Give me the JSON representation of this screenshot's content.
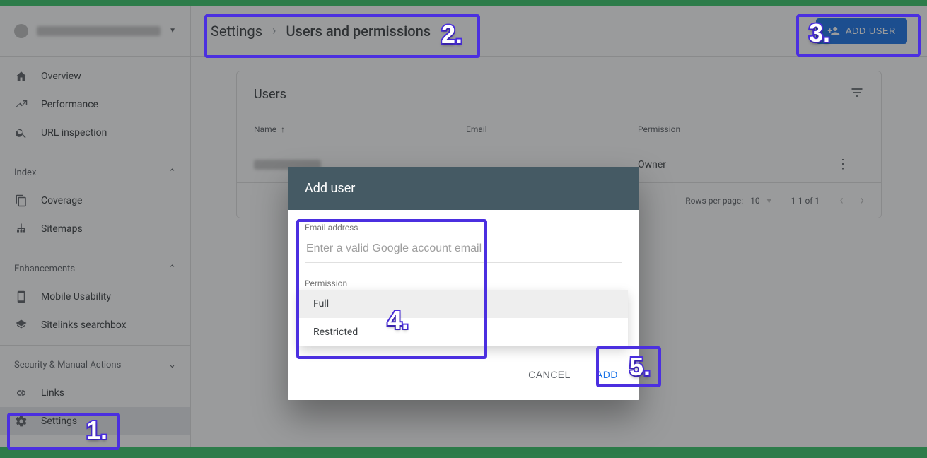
{
  "sidebar": {
    "sections": [
      {
        "items": [
          {
            "name": "overview",
            "label": "Overview",
            "icon": "home"
          },
          {
            "name": "performance",
            "label": "Performance",
            "icon": "trending"
          },
          {
            "name": "url-inspection",
            "label": "URL inspection",
            "icon": "search"
          }
        ]
      },
      {
        "header": "Index",
        "items": [
          {
            "name": "coverage",
            "label": "Coverage",
            "icon": "copy"
          },
          {
            "name": "sitemaps",
            "label": "Sitemaps",
            "icon": "sitemap"
          }
        ]
      },
      {
        "header": "Enhancements",
        "items": [
          {
            "name": "mobile-usability",
            "label": "Mobile Usability",
            "icon": "mobile"
          },
          {
            "name": "sitelinks-searchbox",
            "label": "Sitelinks searchbox",
            "icon": "layers"
          }
        ]
      },
      {
        "header": "Security & Manual Actions",
        "items": [
          {
            "name": "links",
            "label": "Links",
            "icon": "links"
          },
          {
            "name": "settings",
            "label": "Settings",
            "icon": "gear",
            "selected": true
          }
        ]
      }
    ]
  },
  "breadcrumb": {
    "parent": "Settings",
    "current": "Users and permissions"
  },
  "toolbar": {
    "add_user_label": "ADD USER"
  },
  "users_panel": {
    "title": "Users",
    "columns": {
      "name": "Name",
      "email": "Email",
      "permission": "Permission"
    },
    "rows": [
      {
        "permission": "Owner"
      }
    ],
    "footer": {
      "rows_per_page_label": "Rows per page:",
      "page_size": "10",
      "range": "1-1 of 1"
    }
  },
  "dialog": {
    "title": "Add user",
    "email_label": "Email address",
    "email_placeholder": "Enter a valid Google account email",
    "permission_label": "Permission",
    "permission_options": [
      "Full",
      "Restricted"
    ],
    "cancel_label": "CANCEL",
    "add_label": "ADD"
  },
  "annotations": {
    "n1": "1.",
    "n2": "2.",
    "n3": "3.",
    "n4": "4.",
    "n5": "5."
  }
}
